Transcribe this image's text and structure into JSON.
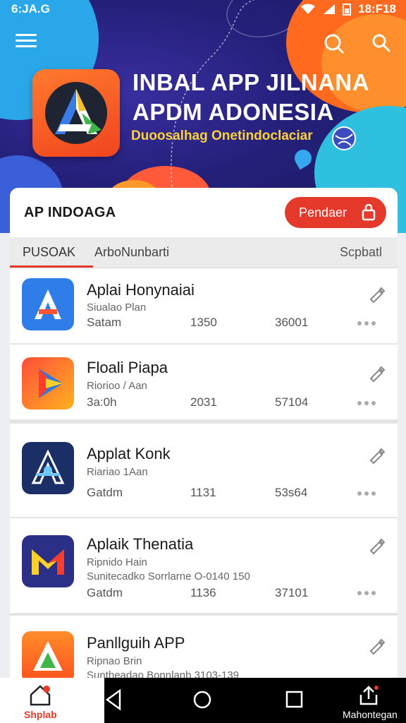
{
  "status_bar": {
    "time": "6:JA.G",
    "clock": "18:F18"
  },
  "hero": {
    "title_line1": "INBAL APP JILNANA",
    "title_line2": "APDM ADONESIA",
    "subtitle": "Duoosalhag Onetindoclaciar"
  },
  "card": {
    "title": "AP INDOAGA",
    "action_label": "Pendaer"
  },
  "tabs": [
    {
      "label": "PUSOAK"
    },
    {
      "label": "ArboNunbarti"
    },
    {
      "label": "Scpbatl"
    }
  ],
  "apps": [
    {
      "name": "Aplai Honynaiai",
      "sub": "Siualao Plan",
      "sub2": "",
      "c1": "Satam",
      "c2": "1350",
      "c3": "36001"
    },
    {
      "name": "Floali Piapa",
      "sub": "Riorioo / Aan",
      "sub2": "",
      "c1": "3a:0h",
      "c2": "2031",
      "c3": "57104"
    },
    {
      "name": "Applat Konk",
      "sub": "Riariao 1Aan",
      "sub2": "",
      "c1": "Gatdm",
      "c2": "1131",
      "c3": "53s64"
    },
    {
      "name": "Aplaik Thenatia",
      "sub": "Ripnido Hain",
      "sub2": "Sunitecadko Sorrlarne O-0140 150",
      "c1": "Gatdm",
      "c2": "1136",
      "c3": "37101"
    },
    {
      "name": "Panllguih APP",
      "sub": "Ripnao Brin",
      "sub2": "Suntheadao Bonnlanb 3103-139",
      "c1": "",
      "c2": "",
      "c3": ""
    }
  ],
  "bottom_nav": {
    "home_label": "Shplab",
    "share_label": "Mahontegan"
  },
  "colors": {
    "accent": "#e5392c",
    "hero_bg": "#24207a",
    "subtitle": "#ffd23a"
  }
}
